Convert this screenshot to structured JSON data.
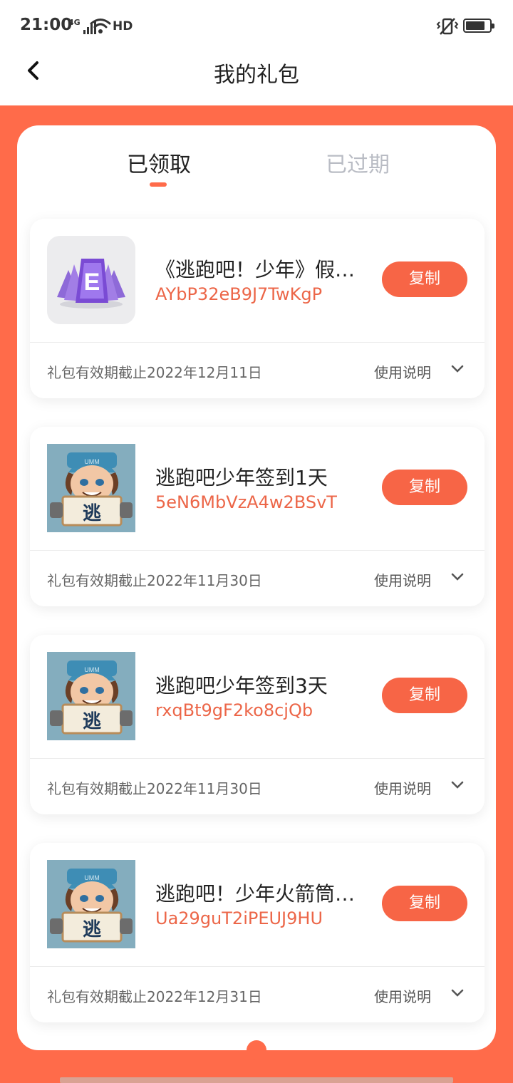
{
  "status_bar": {
    "time": "21:00",
    "network": "4G",
    "hd": "HD"
  },
  "navbar": {
    "title": "我的礼包"
  },
  "tabs": [
    {
      "label": "已领取",
      "active": true
    },
    {
      "label": "已过期",
      "active": false
    }
  ],
  "gifts": [
    {
      "icon": "game-e-cards-icon",
      "name": "《逃跑吧！少年》假期专属礼包",
      "code": "AYbP32eB9J7TwKgP",
      "copy_label": "复制",
      "validity": "礼包有效期截止2022年12月11日",
      "usage_label": "使用说明"
    },
    {
      "icon": "game-character-icon",
      "name": "逃跑吧少年签到1天",
      "code": "5eN6MbVzA4w2BSvT",
      "copy_label": "复制",
      "validity": "礼包有效期截止2022年11月30日",
      "usage_label": "使用说明"
    },
    {
      "icon": "game-character-icon",
      "name": "逃跑吧少年签到3天",
      "code": "rxqBt9gF2ko8cjQb",
      "copy_label": "复制",
      "validity": "礼包有效期截止2022年11月30日",
      "usage_label": "使用说明"
    },
    {
      "icon": "game-character-icon",
      "name": "逃跑吧！少年火箭筒礼包",
      "code": "Ua29guT2iPEUJ9HU",
      "copy_label": "复制",
      "validity": "礼包有效期截止2022年12月31日",
      "usage_label": "使用说明"
    }
  ],
  "colors": {
    "accent": "#ff6b4a",
    "code_text": "#ec6648",
    "copy_button": "#f76546"
  }
}
